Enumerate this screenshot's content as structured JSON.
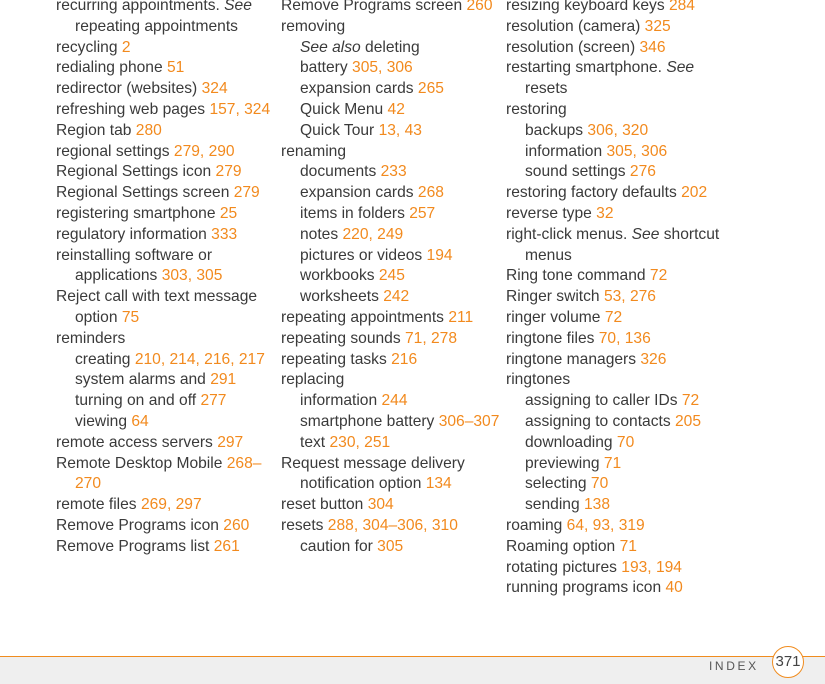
{
  "columns": [
    [
      {
        "t": "recurring appointments. ",
        "see": "See",
        "rest": "repeating appointments",
        "p": "",
        "lvl": 0
      },
      {
        "t": "recycling ",
        "p": "2",
        "lvl": 0
      },
      {
        "t": "redialing phone ",
        "p": "51",
        "lvl": 0
      },
      {
        "t": "redirector (websites) ",
        "p": "324",
        "lvl": 0
      },
      {
        "t": "refreshing web pages ",
        "p": "157, 324",
        "lvl": 0
      },
      {
        "t": "Region tab ",
        "p": "280",
        "lvl": 0
      },
      {
        "t": "regional settings ",
        "p": "279, 290",
        "lvl": 0
      },
      {
        "t": "Regional Settings icon ",
        "p": "279",
        "lvl": 0
      },
      {
        "t": "Regional Settings screen ",
        "p": "279",
        "lvl": 0
      },
      {
        "t": "registering smartphone ",
        "p": "25",
        "lvl": 0
      },
      {
        "t": "regulatory information ",
        "p": "333",
        "lvl": 0
      },
      {
        "t": "reinstalling software or applications ",
        "p": "303, 305",
        "lvl": 0
      },
      {
        "t": "Reject call with text message option ",
        "p": "75",
        "lvl": 0
      },
      {
        "t": "reminders",
        "p": "",
        "lvl": 0
      },
      {
        "t": "creating ",
        "p": "210, 214, 216, 217",
        "lvl": 1
      },
      {
        "t": "system alarms and ",
        "p": "291",
        "lvl": 1
      },
      {
        "t": "turning on and off ",
        "p": "277",
        "lvl": 1
      },
      {
        "t": "viewing ",
        "p": "64",
        "lvl": 1
      },
      {
        "t": "remote access servers ",
        "p": "297",
        "lvl": 0
      },
      {
        "t": "Remote Desktop Mobile ",
        "p": "268–270",
        "lvl": 0
      },
      {
        "t": "remote files ",
        "p": "269, 297",
        "lvl": 0
      },
      {
        "t": "Remove Programs icon ",
        "p": "260",
        "lvl": 0
      },
      {
        "t": "Remove Programs list ",
        "p": "261",
        "lvl": 0
      }
    ],
    [
      {
        "t": "Remove Programs screen ",
        "p": "260",
        "lvl": 0
      },
      {
        "t": "removing",
        "p": "",
        "lvl": 0
      },
      {
        "t": "",
        "see": "See also",
        "rest": " deleting",
        "p": "",
        "lvl": 1
      },
      {
        "t": "battery ",
        "p": "305, 306",
        "lvl": 1
      },
      {
        "t": "expansion cards ",
        "p": "265",
        "lvl": 1
      },
      {
        "t": "Quick Menu ",
        "p": "42",
        "lvl": 1
      },
      {
        "t": "Quick Tour ",
        "p": "13, 43",
        "lvl": 1
      },
      {
        "t": "renaming",
        "p": "",
        "lvl": 0
      },
      {
        "t": "documents ",
        "p": "233",
        "lvl": 1
      },
      {
        "t": "expansion cards ",
        "p": "268",
        "lvl": 1
      },
      {
        "t": "items in folders ",
        "p": "257",
        "lvl": 1
      },
      {
        "t": "notes ",
        "p": "220, 249",
        "lvl": 1
      },
      {
        "t": "pictures or videos ",
        "p": "194",
        "lvl": 1
      },
      {
        "t": "workbooks ",
        "p": "245",
        "lvl": 1
      },
      {
        "t": "worksheets ",
        "p": "242",
        "lvl": 1
      },
      {
        "t": "repeating appointments ",
        "p": "211",
        "lvl": 0
      },
      {
        "t": "repeating sounds ",
        "p": "71, 278",
        "lvl": 0
      },
      {
        "t": "repeating tasks ",
        "p": "216",
        "lvl": 0
      },
      {
        "t": "replacing",
        "p": "",
        "lvl": 0
      },
      {
        "t": "information ",
        "p": "244",
        "lvl": 1
      },
      {
        "t": "smartphone battery ",
        "p": "306–307",
        "lvl": 1
      },
      {
        "t": "text ",
        "p": "230, 251",
        "lvl": 1
      },
      {
        "t": "Request message delivery notification option ",
        "p": "134",
        "lvl": 0
      },
      {
        "t": "reset button ",
        "p": "304",
        "lvl": 0
      },
      {
        "t": "resets ",
        "p": "288, 304–306, 310",
        "lvl": 0
      },
      {
        "t": "caution for ",
        "p": "305",
        "lvl": 1
      }
    ],
    [
      {
        "t": "resizing keyboard keys ",
        "p": "284",
        "lvl": 0
      },
      {
        "t": "resolution (camera) ",
        "p": "325",
        "lvl": 0
      },
      {
        "t": "resolution (screen) ",
        "p": "346",
        "lvl": 0
      },
      {
        "t": "restarting smartphone. ",
        "see": "See",
        "rest": " resets",
        "p": "",
        "lvl": 0
      },
      {
        "t": "restoring",
        "p": "",
        "lvl": 0
      },
      {
        "t": "backups ",
        "p": "306, 320",
        "lvl": 1
      },
      {
        "t": "information ",
        "p": "305, 306",
        "lvl": 1
      },
      {
        "t": "sound settings ",
        "p": "276",
        "lvl": 1
      },
      {
        "t": "restoring factory defaults ",
        "p": "202",
        "lvl": 0
      },
      {
        "t": "reverse type ",
        "p": "32",
        "lvl": 0
      },
      {
        "t": "right-click menus. ",
        "see": "See",
        "rest": " shortcut menus",
        "p": "",
        "lvl": 0
      },
      {
        "t": "Ring tone command ",
        "p": "72",
        "lvl": 0
      },
      {
        "t": "Ringer switch ",
        "p": "53, 276",
        "lvl": 0
      },
      {
        "t": "ringer volume ",
        "p": "72",
        "lvl": 0
      },
      {
        "t": "ringtone files ",
        "p": "70, 136",
        "lvl": 0
      },
      {
        "t": "ringtone managers ",
        "p": "326",
        "lvl": 0
      },
      {
        "t": "ringtones",
        "p": "",
        "lvl": 0
      },
      {
        "t": "assigning to caller IDs ",
        "p": "72",
        "lvl": 1
      },
      {
        "t": "assigning to contacts ",
        "p": "205",
        "lvl": 1
      },
      {
        "t": "downloading ",
        "p": "70",
        "lvl": 1
      },
      {
        "t": "previewing ",
        "p": "71",
        "lvl": 1
      },
      {
        "t": "selecting ",
        "p": "70",
        "lvl": 1
      },
      {
        "t": "sending ",
        "p": "138",
        "lvl": 1
      },
      {
        "t": "roaming ",
        "p": "64, 93, 319",
        "lvl": 0
      },
      {
        "t": "Roaming option ",
        "p": "71",
        "lvl": 0
      },
      {
        "t": "rotating pictures ",
        "p": "193, 194",
        "lvl": 0
      },
      {
        "t": "running programs icon ",
        "p": "40",
        "lvl": 0
      }
    ]
  ],
  "footer": {
    "section_label": "INDEX",
    "page_number": "371"
  },
  "colors": {
    "accent": "#f08c1e",
    "page_ref": "#f28a1e",
    "text": "#3a3a3a",
    "footer_bg": "#efefef"
  }
}
